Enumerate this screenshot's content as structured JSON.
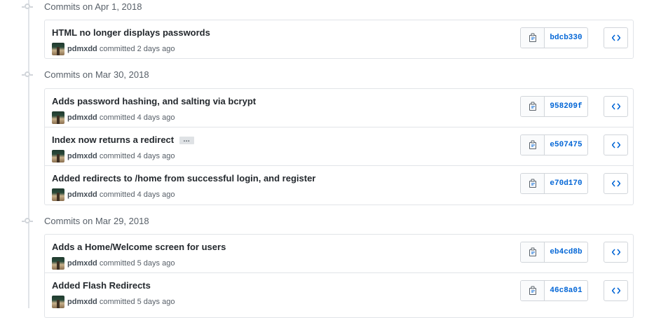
{
  "colors": {
    "accent": "#0366d6",
    "border": "#e1e4e8",
    "muted_text": "#586069",
    "title_text": "#24292e"
  },
  "icons": {
    "copy": "clippy-icon",
    "browse": "code-icon",
    "timeline": "git-commit-icon"
  },
  "groups": [
    {
      "title": "Commits on Apr 1, 2018",
      "commits": [
        {
          "title": "HTML no longer displays passwords",
          "author": "pdmxdd",
          "time": "committed 2 days ago",
          "sha": "bdcb330",
          "has_ellipsis": false
        }
      ]
    },
    {
      "title": "Commits on Mar 30, 2018",
      "commits": [
        {
          "title": "Adds password hashing, and salting via bcrypt",
          "author": "pdmxdd",
          "time": "committed 4 days ago",
          "sha": "958209f",
          "has_ellipsis": false
        },
        {
          "title": "Index now returns a redirect",
          "author": "pdmxdd",
          "time": "committed 4 days ago",
          "sha": "e507475",
          "has_ellipsis": true,
          "ellipsis_label": "…"
        },
        {
          "title": "Added redirects to /home from successful login, and register",
          "author": "pdmxdd",
          "time": "committed 4 days ago",
          "sha": "e70d170",
          "has_ellipsis": false
        }
      ]
    },
    {
      "title": "Commits on Mar 29, 2018",
      "commits": [
        {
          "title": "Adds a Home/Welcome screen for users",
          "author": "pdmxdd",
          "time": "committed 5 days ago",
          "sha": "eb4cd8b",
          "has_ellipsis": false
        },
        {
          "title": "Added Flash Redirects",
          "author": "pdmxdd",
          "time": "committed 5 days ago",
          "sha": "46c8a01",
          "has_ellipsis": false
        }
      ]
    }
  ]
}
